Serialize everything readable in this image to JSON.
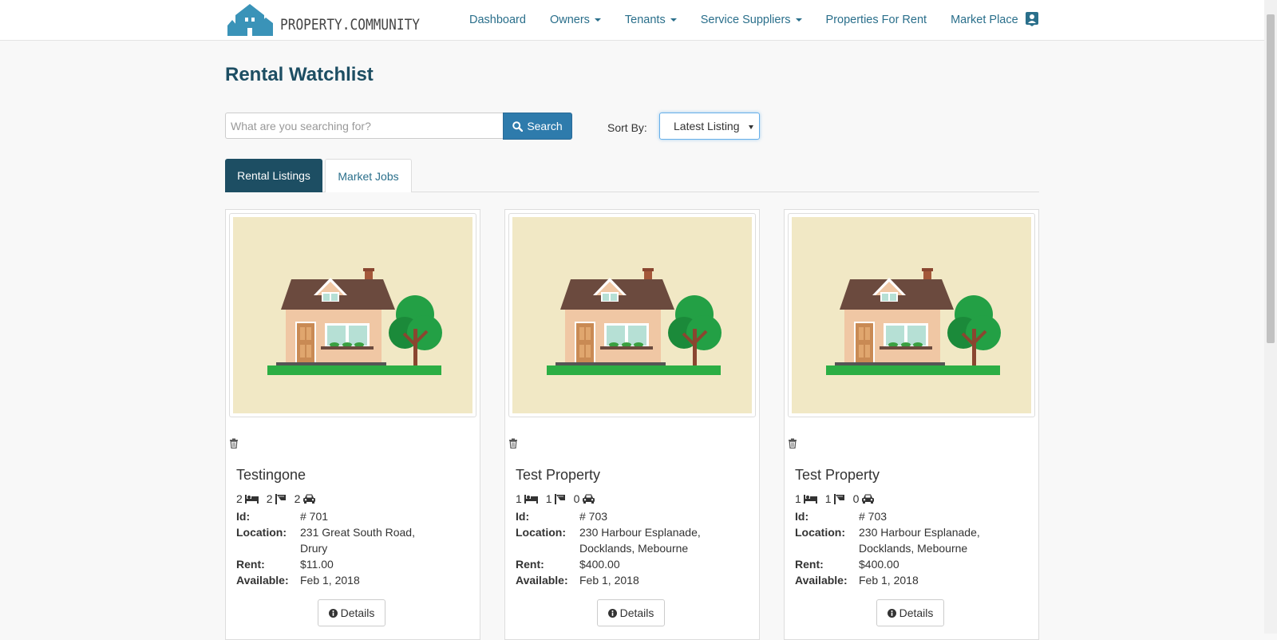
{
  "brand": {
    "name": "PROPERTY.COMMUNITY",
    "color": "#3a93b8"
  },
  "nav": {
    "items": [
      {
        "label": "Dashboard",
        "dropdown": false
      },
      {
        "label": "Owners",
        "dropdown": true
      },
      {
        "label": "Tenants",
        "dropdown": true
      },
      {
        "label": "Service Suppliers",
        "dropdown": true
      },
      {
        "label": "Properties For Rent",
        "dropdown": false
      },
      {
        "label": "Market Place",
        "dropdown": false
      }
    ],
    "profile_icon": "user-card-icon"
  },
  "page": {
    "title": "Rental Watchlist"
  },
  "search": {
    "placeholder": "What are you searching for?",
    "value": "",
    "button_label": "Search"
  },
  "sort": {
    "label": "Sort By:",
    "selected": "Latest Listing"
  },
  "tabs": [
    {
      "label": "Rental Listings",
      "active": true
    },
    {
      "label": "Market Jobs",
      "active": false
    }
  ],
  "listings": [
    {
      "title": "Testingone",
      "beds": "2",
      "baths": "2",
      "cars": "2",
      "id_label": "Id:",
      "id": "# 701",
      "location_label": "Location:",
      "location": "231 Great South Road, Drury",
      "rent_label": "Rent:",
      "rent": "$11.00",
      "available_label": "Available:",
      "available": "Feb 1, 2018",
      "details_label": "Details"
    },
    {
      "title": "Test Property",
      "beds": "1",
      "baths": "1",
      "cars": "0",
      "id_label": "Id:",
      "id": "# 703",
      "location_label": "Location:",
      "location": "230 Harbour Esplanade, Docklands, Mebourne",
      "rent_label": "Rent:",
      "rent": "$400.00",
      "available_label": "Available:",
      "available": "Feb 1, 2018",
      "details_label": "Details"
    },
    {
      "title": "Test Property",
      "beds": "1",
      "baths": "1",
      "cars": "0",
      "id_label": "Id:",
      "id": "# 703",
      "location_label": "Location:",
      "location": "230 Harbour Esplanade, Docklands, Mebourne",
      "rent_label": "Rent:",
      "rent": "$400.00",
      "available_label": "Available:",
      "available": "Feb 1, 2018",
      "details_label": "Details"
    }
  ],
  "colors": {
    "nav_link": "#2a6f8b",
    "title": "#1d4e63",
    "active_tab": "#1d4e63",
    "search_button": "#2e7bac",
    "image_bg": "#f1e8c5"
  }
}
